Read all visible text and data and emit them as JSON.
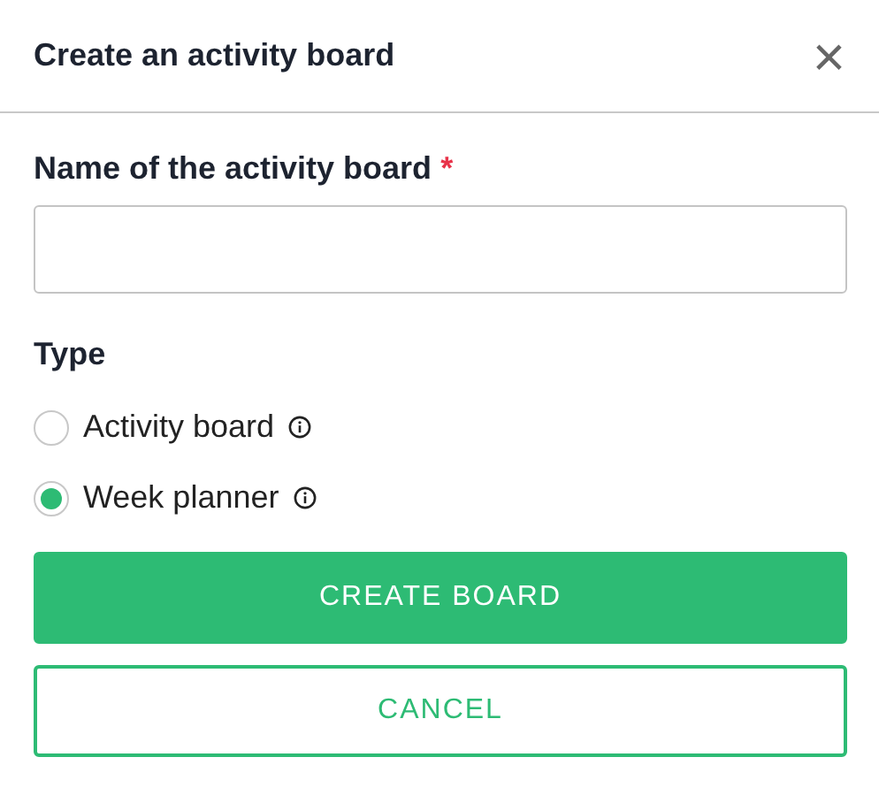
{
  "dialog": {
    "title": "Create an activity board",
    "close": "×"
  },
  "name_field": {
    "label": "Name of the activity board",
    "required_mark": "*"
  },
  "type": {
    "label": "Type",
    "options": [
      {
        "label": "Activity board",
        "selected": false,
        "info": true
      },
      {
        "label": "Week planner",
        "selected": true,
        "info": true
      }
    ]
  },
  "buttons": [
    {
      "label": "CREATE BOARD",
      "kind": "primary"
    },
    {
      "label": "CANCEL",
      "kind": "secondary"
    }
  ]
}
